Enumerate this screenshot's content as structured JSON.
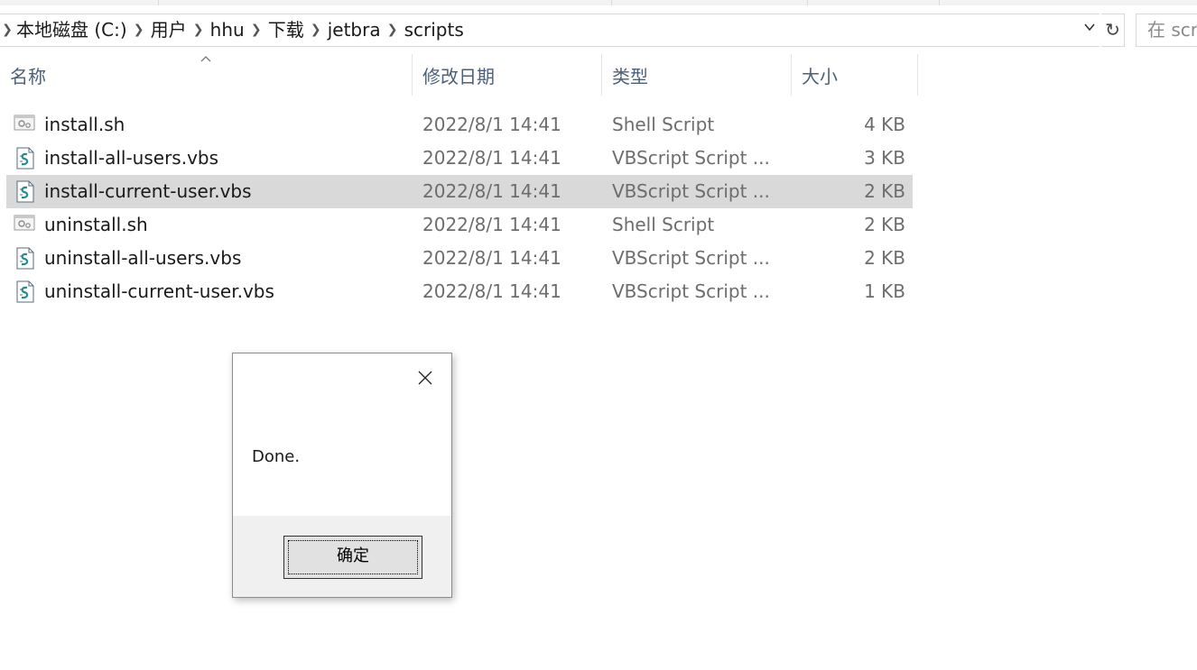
{
  "address_bar": {
    "breadcrumbs": [
      "本地磁盘 (C:)",
      "用户",
      "hhu",
      "下载",
      "jetbra",
      "scripts"
    ],
    "search_placeholder": "在 scr"
  },
  "columns": {
    "name": "名称",
    "date_modified": "修改日期",
    "type": "类型",
    "size": "大小"
  },
  "files": [
    {
      "name": "install.sh",
      "date": "2022/8/1 14:41",
      "type": "Shell Script",
      "size": "4 KB",
      "icon": "shell-script-icon",
      "selected": false
    },
    {
      "name": "install-all-users.vbs",
      "date": "2022/8/1 14:41",
      "type": "VBScript Script ...",
      "size": "3 KB",
      "icon": "vbscript-icon",
      "selected": false
    },
    {
      "name": "install-current-user.vbs",
      "date": "2022/8/1 14:41",
      "type": "VBScript Script ...",
      "size": "2 KB",
      "icon": "vbscript-icon",
      "selected": true
    },
    {
      "name": "uninstall.sh",
      "date": "2022/8/1 14:41",
      "type": "Shell Script",
      "size": "2 KB",
      "icon": "shell-script-icon",
      "selected": false
    },
    {
      "name": "uninstall-all-users.vbs",
      "date": "2022/8/1 14:41",
      "type": "VBScript Script ...",
      "size": "2 KB",
      "icon": "vbscript-icon",
      "selected": false
    },
    {
      "name": "uninstall-current-user.vbs",
      "date": "2022/8/1 14:41",
      "type": "VBScript Script ...",
      "size": "1 KB",
      "icon": "vbscript-icon",
      "selected": false
    }
  ],
  "dialog": {
    "message": "Done.",
    "ok_label": "确定"
  },
  "colors": {
    "selected_row": "#d9d9d9",
    "header_text": "#4c607a",
    "dialog_footer": "#f0f0f0"
  }
}
